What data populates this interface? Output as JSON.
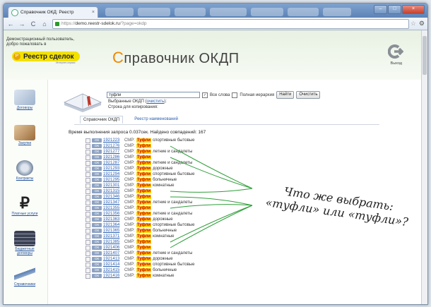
{
  "browser": {
    "tab_title": "Справочник ОКД: Реестр",
    "tab_close": "×",
    "url_scheme": "https://",
    "url_host": "demo.reestr-sdelok.ru",
    "url_path": "/?page=okdp",
    "nav_back": "←",
    "nav_forward": "→",
    "nav_reload": "C",
    "nav_home": "⌂",
    "star": "☆",
    "wrench": "⚙",
    "win_min": "–",
    "win_max": "□",
    "win_close": "×"
  },
  "header": {
    "welcome_line1": "Демонстрационный пользователь,",
    "welcome_line2": "добро пожаловать в",
    "logo_text": "Реестр сделок",
    "logo_circle": "Р",
    "logo_tagline": "Интернет-сервис",
    "title_cap": "С",
    "title_rest": "правочник ОКДП",
    "exit_label": "Выход"
  },
  "sidebar": {
    "items": [
      {
        "label": "Договоры",
        "icon": "documents-icon",
        "color": "#9fb3cc"
      },
      {
        "label": "Закупки",
        "icon": "gavel-icon",
        "color": "#9a6b3a"
      },
      {
        "label": "Контракты",
        "icon": "seal-icon",
        "color": "#6d7f99"
      },
      {
        "label": "Платные услуги",
        "icon": "ruble-icon",
        "color": "#222222"
      },
      {
        "label": "Бюджетные договоры",
        "icon": "server-icon",
        "color": "#2b3140"
      },
      {
        "label": "Справочники",
        "icon": "pen-icon",
        "color": "#5b7fb0"
      }
    ]
  },
  "search": {
    "value": "туфли",
    "all_words_label": "Все слова",
    "hierarchy_label": "Полная иерархия",
    "find_button": "Найти",
    "clear_button": "Очистить"
  },
  "selected": {
    "prefix": "Выбранные ОКДП (",
    "link": "очистить",
    "suffix": "):",
    "copy_label": "Строка для копирования:"
  },
  "content_tabs": [
    "Справочник ОКДП",
    "Реестр наименований"
  ],
  "query_time": "Время выполнения запроса 0.037сек. Найдено совпадений: 167",
  "results": [
    {
      "code": "1921223",
      "rest": " спортивные бытовые"
    },
    {
      "code": "1921276",
      "rest": ""
    },
    {
      "code": "1921277",
      "rest": " летние и сандалеты"
    },
    {
      "code": "1921286",
      "rest": ""
    },
    {
      "code": "1921287",
      "rest": " летние и сандалеты"
    },
    {
      "code": "1921293",
      "rest": " дорожные"
    },
    {
      "code": "1921294",
      "rest": " спортивные бытовые"
    },
    {
      "code": "1921295",
      "rest": " больничные"
    },
    {
      "code": "1921301",
      "rest": " комнатные"
    },
    {
      "code": "1921315",
      "rest": ""
    },
    {
      "code": "1921346",
      "rest": ""
    },
    {
      "code": "1921347",
      "rest": " летние и сандалеты"
    },
    {
      "code": "1921355",
      "rest": ""
    },
    {
      "code": "1921356",
      "rest": " летние и сандалеты"
    },
    {
      "code": "1921363",
      "rest": " дорожные"
    },
    {
      "code": "1921364",
      "rest": " спортивные бытовые"
    },
    {
      "code": "1921365",
      "rest": " больничные"
    },
    {
      "code": "1921371",
      "rest": " комнатные"
    },
    {
      "code": "1921385",
      "rest": ""
    },
    {
      "code": "1921406",
      "rest": ""
    },
    {
      "code": "1921407",
      "rest": " летние и сандалеты"
    },
    {
      "code": "1921413",
      "rest": " дорожные"
    },
    {
      "code": "1921414",
      "rest": " спортивные бытовые"
    },
    {
      "code": "1921415",
      "rest": " больничные"
    },
    {
      "code": "1921416",
      "rest": " комнатные"
    }
  ],
  "result_common": {
    "badge": "ОК",
    "smr": "СМР:",
    "highlight": "Туфли"
  },
  "annotation": {
    "line1": "Что же выбрать:",
    "line2": "«туфли» или «туфли»?",
    "color": "#2f9e3a"
  }
}
